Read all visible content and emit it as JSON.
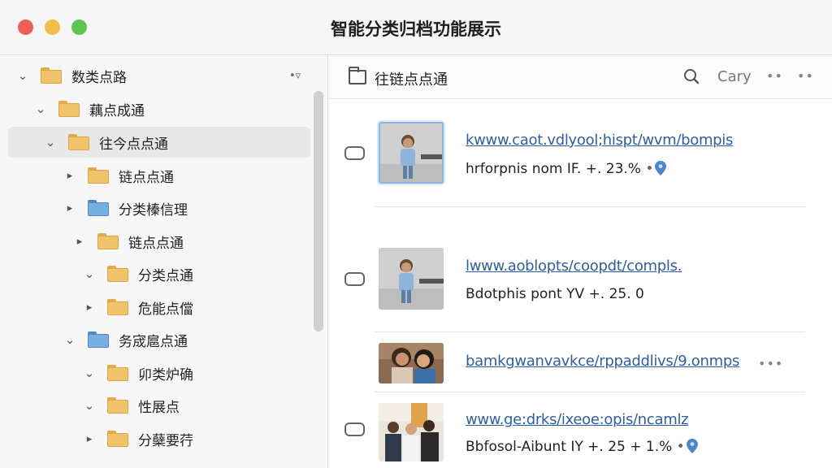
{
  "window": {
    "title": "智能分类归档功能展示"
  },
  "sidebar": {
    "tool_icon": "filter-icon",
    "items": [
      {
        "label": "数类点路",
        "expanded": true,
        "folder_color": "yellow"
      },
      {
        "label": "藕点成通",
        "expanded": true,
        "folder_color": "yellow"
      },
      {
        "label": "往今点点通",
        "expanded": true,
        "folder_color": "yellow",
        "selected": true
      },
      {
        "label": "链点点通",
        "expanded": false,
        "folder_color": "yellow"
      },
      {
        "label": "分类榛信理",
        "expanded": false,
        "folder_color": "blue"
      },
      {
        "label": "链点点通",
        "expanded": false,
        "folder_color": "yellow"
      },
      {
        "label": "分类点通",
        "expanded": true,
        "folder_color": "yellow"
      },
      {
        "label": "危能点儅",
        "expanded": false,
        "folder_color": "yellow"
      },
      {
        "label": "务宬扈点通",
        "expanded": true,
        "folder_color": "blue"
      },
      {
        "label": "卯类炉确",
        "expanded": true,
        "folder_color": "yellow"
      },
      {
        "label": "性展点",
        "expanded": true,
        "folder_color": "yellow"
      },
      {
        "label": "分蘖要荇",
        "expanded": false,
        "folder_color": "yellow"
      }
    ]
  },
  "main": {
    "header": {
      "title": "往链点点通",
      "user": "Cary",
      "search_icon": "search-icon",
      "more": "••"
    },
    "items": [
      {
        "url": "kwww.caot.vdlyool;hispt/wvm/bompis",
        "meta": "hrforpnis nom IF. +. 23.%",
        "has_pin": true,
        "thumb_selected": true,
        "thumb": "child"
      },
      {
        "url": "lwww.aoblopts/coopdt/compls.",
        "meta": "Bdotphis pont YV +. 25. 0",
        "has_pin": false,
        "thumb_selected": false,
        "thumb": "child"
      },
      {
        "url": "bamkgwanvavkce/rppaddlivs/9.onmps",
        "meta": "",
        "has_pin": false,
        "thumb_selected": false,
        "thumb": "women",
        "more": "•••"
      },
      {
        "url": "www.ge:drks/ixeoe:opis/ncamlz",
        "meta": "Bbfosol-Aibunt IY +. 25 + 1.%",
        "has_pin": true,
        "thumb_selected": false,
        "thumb": "group"
      }
    ]
  },
  "colors": {
    "accent": "#2f5f9e",
    "pin": "#4a86c8",
    "folder": "#f1c36b",
    "folder_blue": "#79aee0"
  }
}
